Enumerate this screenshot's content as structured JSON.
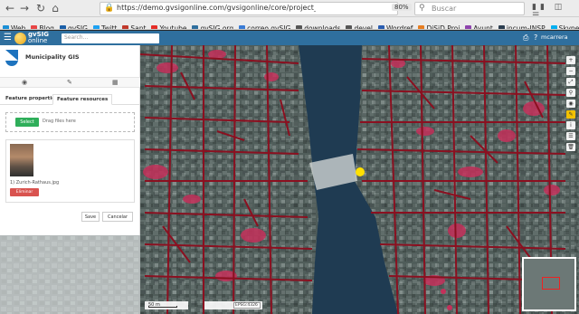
{
  "browser": {
    "url": "https://demo.gvsigonline.com/gvsigonline/core/project_load",
    "zoom": "80%",
    "search_placeholder": "Buscar",
    "bookmarks": [
      {
        "label": "Web",
        "color": "#1b8fd6"
      },
      {
        "label": "Blog",
        "color": "#e84545"
      },
      {
        "label": "gvSIG",
        "color": "#1b5fa8"
      },
      {
        "label": "Twitt",
        "color": "#1da1f2"
      },
      {
        "label": "Sant",
        "color": "#c0392b"
      },
      {
        "label": "Youtube",
        "color": "#e52d27"
      },
      {
        "label": "gvSIG.org",
        "color": "#2f6f9e"
      },
      {
        "label": "correo gvSIG",
        "color": "#3a7bd5"
      },
      {
        "label": "downloads",
        "color": "#555555"
      },
      {
        "label": "devel",
        "color": "#555555"
      },
      {
        "label": "Wordref",
        "color": "#2a5db0"
      },
      {
        "label": "DiSiD Proj",
        "color": "#e67e22"
      },
      {
        "label": "Ayunt",
        "color": "#8e44ad"
      },
      {
        "label": "incum-INSP",
        "color": "#2c3e50"
      },
      {
        "label": "Skype error",
        "color": "#00aff0"
      }
    ]
  },
  "app": {
    "logo_line1": "gvSIG",
    "logo_line2": "online",
    "search_placeholder": "Search...",
    "user": "mcarrera"
  },
  "panel": {
    "title": "Municipality GIS",
    "subtabs": [
      "Feature properties",
      "Feature resources"
    ],
    "select_button": "Select",
    "drag_hint": "Drag files here",
    "file_name": "1) Zurich-Rathaus.jpg",
    "delete_button": "Eliminar",
    "save_button": "Save",
    "cancel_button": "Cancelar"
  },
  "map": {
    "scale_label": "50 m",
    "crs_label": "EPSG:4326",
    "colors": {
      "parcels": "#8b1020",
      "vegetation": "#c4305a",
      "water": "#1f3b52",
      "highlight": "#ffe000"
    }
  },
  "tools": [
    "plus-icon",
    "minus-icon",
    "expand-icon",
    "search-icon",
    "location-icon",
    "edit-icon",
    "info-icon",
    "layers-icon",
    "trash-icon"
  ]
}
